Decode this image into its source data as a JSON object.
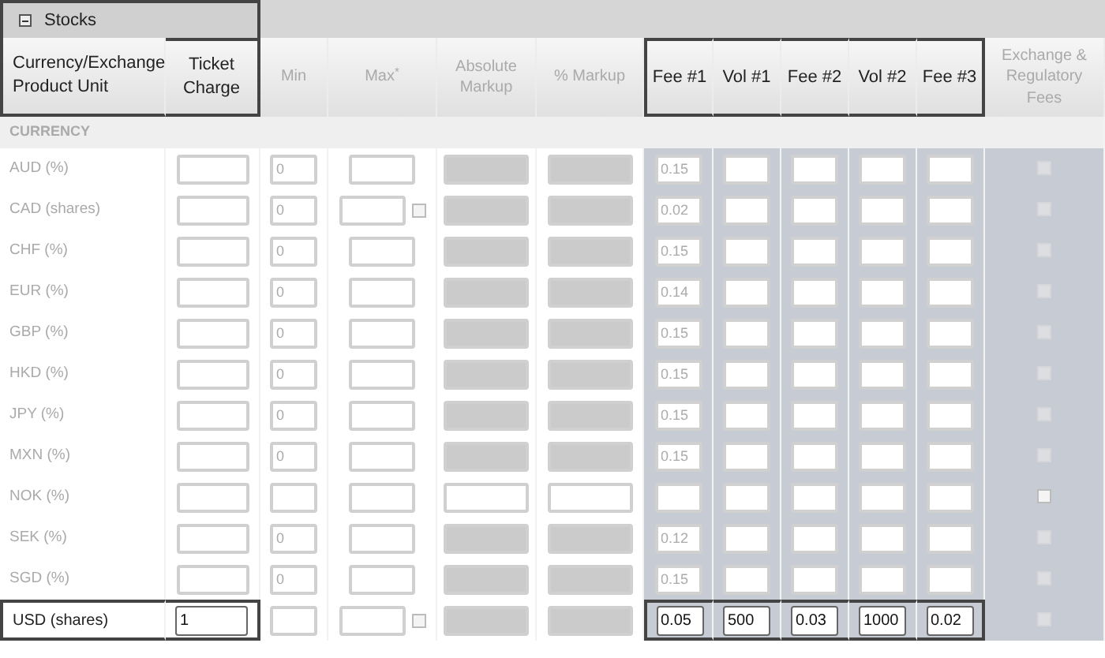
{
  "section": {
    "title": "Stocks",
    "expanded": true,
    "emphasized": true
  },
  "columns": [
    {
      "label": "Currency/Exchange Product Unit",
      "emphasized": true
    },
    {
      "label": "Ticket Charge",
      "emphasized": true
    },
    {
      "label": "Min",
      "emphasized": false
    },
    {
      "label": "Max$^{*}$",
      "emphasized": false
    },
    {
      "label": "Absolute Markup",
      "emphasized": false
    },
    {
      "label": "% Markup",
      "emphasized": false
    },
    {
      "label": "Fee #1",
      "emphasized": true
    },
    {
      "label": "Vol #1",
      "emphasized": true
    },
    {
      "label": "Fee #2",
      "emphasized": true
    },
    {
      "label": "Vol #2",
      "emphasized": true
    },
    {
      "label": "Fee #3",
      "emphasized": true
    },
    {
      "label": "Exchange & Regulatory Fees",
      "emphasized": false
    }
  ],
  "group": {
    "label": "CURRENCY"
  },
  "rows": [
    {
      "label": "AUD (%)",
      "emphasized": false,
      "min": "0",
      "markup_disabled": true,
      "fee_1": "0.15",
      "exchange_disabled": true
    },
    {
      "label": "CAD (shares)",
      "emphasized": false,
      "min": "0",
      "max_toggle": {
        "checked": false
      },
      "markup_disabled": true,
      "fee_1": "0.02",
      "exchange_disabled": true
    },
    {
      "label": "CHF (%)",
      "emphasized": false,
      "min": "0",
      "markup_disabled": true,
      "fee_1": "0.15",
      "exchange_disabled": true
    },
    {
      "label": "EUR (%)",
      "emphasized": false,
      "min": "0",
      "markup_disabled": true,
      "fee_1": "0.14",
      "exchange_disabled": true
    },
    {
      "label": "GBP (%)",
      "emphasized": false,
      "min": "0",
      "markup_disabled": true,
      "fee_1": "0.15",
      "exchange_disabled": true
    },
    {
      "label": "HKD (%)",
      "emphasized": false,
      "min": "0",
      "markup_disabled": true,
      "fee_1": "0.15",
      "exchange_disabled": true
    },
    {
      "label": "JPY (%)",
      "emphasized": false,
      "min": "0",
      "markup_disabled": true,
      "fee_1": "0.15",
      "exchange_disabled": true
    },
    {
      "label": "MXN (%)",
      "emphasized": false,
      "min": "0",
      "markup_disabled": true,
      "fee_1": "0.15",
      "exchange_disabled": true
    },
    {
      "label": "NOK (%)",
      "emphasized": false,
      "markup_disabled": false,
      "exchange_disabled": false
    },
    {
      "label": "SEK (%)",
      "emphasized": false,
      "min": "0",
      "markup_disabled": true,
      "fee_1": "0.12",
      "exchange_disabled": true
    },
    {
      "label": "SGD (%)",
      "emphasized": false,
      "min": "0",
      "markup_disabled": true,
      "fee_1": "0.15",
      "exchange_disabled": true
    },
    {
      "label": "USD (shares)",
      "emphasized": true,
      "ticket": "1",
      "max_toggle": {
        "checked": false
      },
      "markup_disabled": true,
      "fee_1": "0.05",
      "vol_1": "500",
      "fee_2": "0.03",
      "vol_2": "1000",
      "fee_3": "0.02",
      "exchange_disabled": true
    }
  ]
}
